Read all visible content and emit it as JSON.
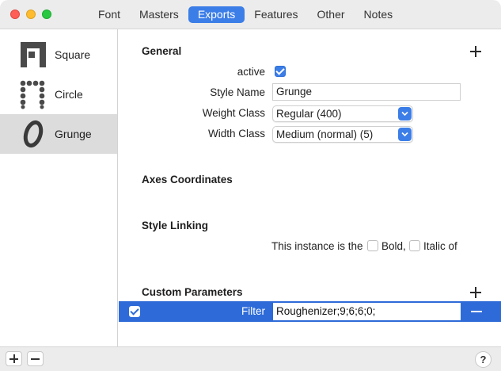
{
  "window": {
    "tabs": [
      {
        "label": "Font",
        "active": false
      },
      {
        "label": "Masters",
        "active": false
      },
      {
        "label": "Exports",
        "active": true
      },
      {
        "label": "Features",
        "active": false
      },
      {
        "label": "Other",
        "active": false
      },
      {
        "label": "Notes",
        "active": false
      }
    ]
  },
  "sidebar": {
    "instances": [
      {
        "name": "Square",
        "selected": false,
        "glyph": "square-n-glyph-icon"
      },
      {
        "name": "Circle",
        "selected": false,
        "glyph": "dotted-n-glyph-icon"
      },
      {
        "name": "Grunge",
        "selected": true,
        "glyph": "italic-o-glyph-icon"
      }
    ]
  },
  "general": {
    "title": "General",
    "active_label": "active",
    "active_checked": true,
    "style_name_label": "Style Name",
    "style_name_value": "Grunge",
    "weight_class_label": "Weight Class",
    "weight_class_value": "Regular (400)",
    "width_class_label": "Width Class",
    "width_class_value": "Medium (normal) (5)"
  },
  "axes": {
    "title": "Axes Coordinates"
  },
  "style_linking": {
    "title": "Style Linking",
    "prefix": "This instance is the",
    "bold_label": "Bold,",
    "italic_label": "Italic of"
  },
  "custom_parameters": {
    "title": "Custom Parameters",
    "rows": [
      {
        "enabled": true,
        "name": "Filter",
        "value": "Roughenizer;9;6;6;0;"
      }
    ]
  },
  "bottom": {
    "help_label": "?"
  },
  "colors": {
    "accent": "#3c7ee8",
    "selection_row": "#2e6bd8",
    "sidebar_selected": "#dcdcdc"
  }
}
